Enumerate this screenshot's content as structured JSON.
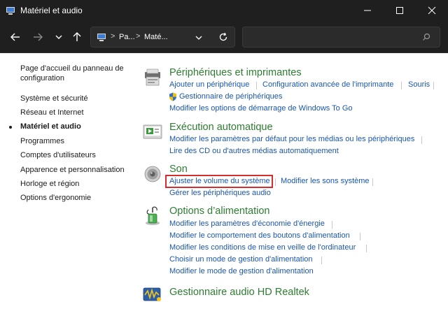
{
  "window": {
    "title": "Matériel et audio"
  },
  "address": {
    "crumb1": "Pa...",
    "crumb2": "Maté...",
    "separator": ">"
  },
  "search": {
    "placeholder": ""
  },
  "sidebar": {
    "home": "Page d'accueil du panneau de configuration",
    "items": [
      "Système et sécurité",
      "Réseau et Internet",
      "Matériel et audio",
      "Programmes",
      "Comptes d'utilisateurs",
      "Apparence et personnalisation",
      "Horloge et région",
      "Options d'ergonomie"
    ],
    "active_index": 2
  },
  "categories": {
    "devices": {
      "title": "Périphériques et imprimantes",
      "links": [
        "Ajouter un périphérique",
        "Configuration avancée de l'imprimante",
        "Souris",
        "Gestionnaire de périphériques",
        "Modifier les options de démarrage de Windows To Go"
      ]
    },
    "autoplay": {
      "title": "Exécution automatique",
      "links": [
        "Modifier les paramètres par défaut pour les médias ou les périphériques",
        "Lire des CD ou d'autres médias automatiquement"
      ]
    },
    "sound": {
      "title": "Son",
      "links": [
        "Ajuster le volume du système",
        "Modifier les sons système",
        "Gérer les périphériques audio"
      ]
    },
    "power": {
      "title": "Options d’alimentation",
      "links": [
        "Modifier les paramètres d'économie d'énergie",
        "Modifier le comportement des boutons d'alimentation",
        "Modifier les conditions de mise en veille de l'ordinateur",
        "Choisir un mode de gestion d'alimentation",
        "Modifier le mode de gestion d'alimentation"
      ]
    },
    "realtek": {
      "title": "Gestionnaire audio HD Realtek"
    }
  },
  "colors": {
    "title_green": "#2e7d32",
    "link_blue": "#1a56b0",
    "highlight_red": "#d32f2f",
    "chrome_dark": "#1f1f1f"
  }
}
